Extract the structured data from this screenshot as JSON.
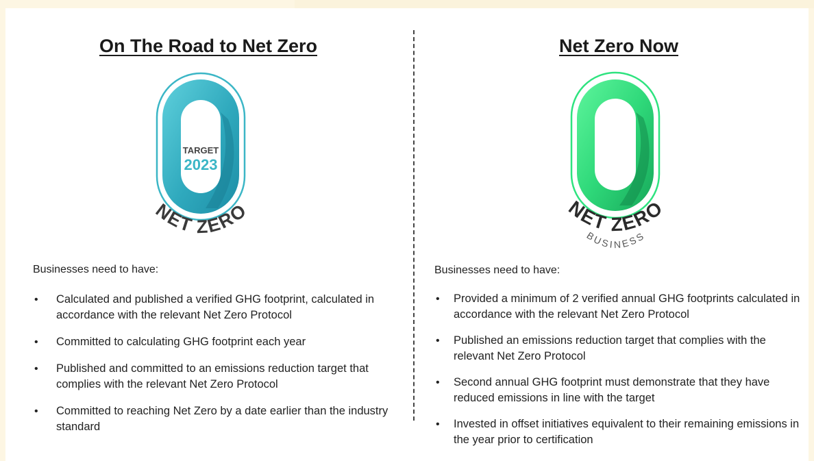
{
  "left": {
    "heading": "On The Road to Net Zero",
    "badge": {
      "target_label": "TARGET",
      "target_year": "2023",
      "arc_text": "NET ZERO",
      "ring_color": "#3bb6c6"
    },
    "intro": "Businesses need to have:",
    "items": [
      {
        "bullet": "•",
        "text": "Calculated and published a verified GHG footprint, calculated in accordance with the relevant Net Zero Protocol"
      },
      {
        "bullet": "•",
        "text": "Committed to calculating GHG footprint each year"
      },
      {
        "bullet": "•",
        "text": "Published and committed to an emissions reduction target that complies with the relevant Net Zero Protocol"
      },
      {
        "bullet": "•",
        "text": "Committed to reaching Net Zero by a date earlier than the industry standard"
      }
    ]
  },
  "right": {
    "heading": "Net Zero Now",
    "badge": {
      "arc_text": "NET ZERO",
      "sub_text": "BUSINESS",
      "ring_color": "#2ee37f"
    },
    "intro": "Businesses need to have:",
    "items": [
      {
        "bullet": "•",
        "text": "Provided a minimum of 2 verified annual GHG footprints calculated in accordance with the relevant Net Zero Protocol"
      },
      {
        "bullet": "•",
        "text": "Published an emissions reduction target that complies with the relevant Net Zero Protocol"
      },
      {
        "bullet": "•",
        "text": "Second annual GHG footprint must demonstrate that they have reduced emissions in line with the target"
      },
      {
        "bullet": "•",
        "text": "Invested in offset initiatives equivalent to their remaining emissions in the year prior to certification"
      }
    ]
  }
}
